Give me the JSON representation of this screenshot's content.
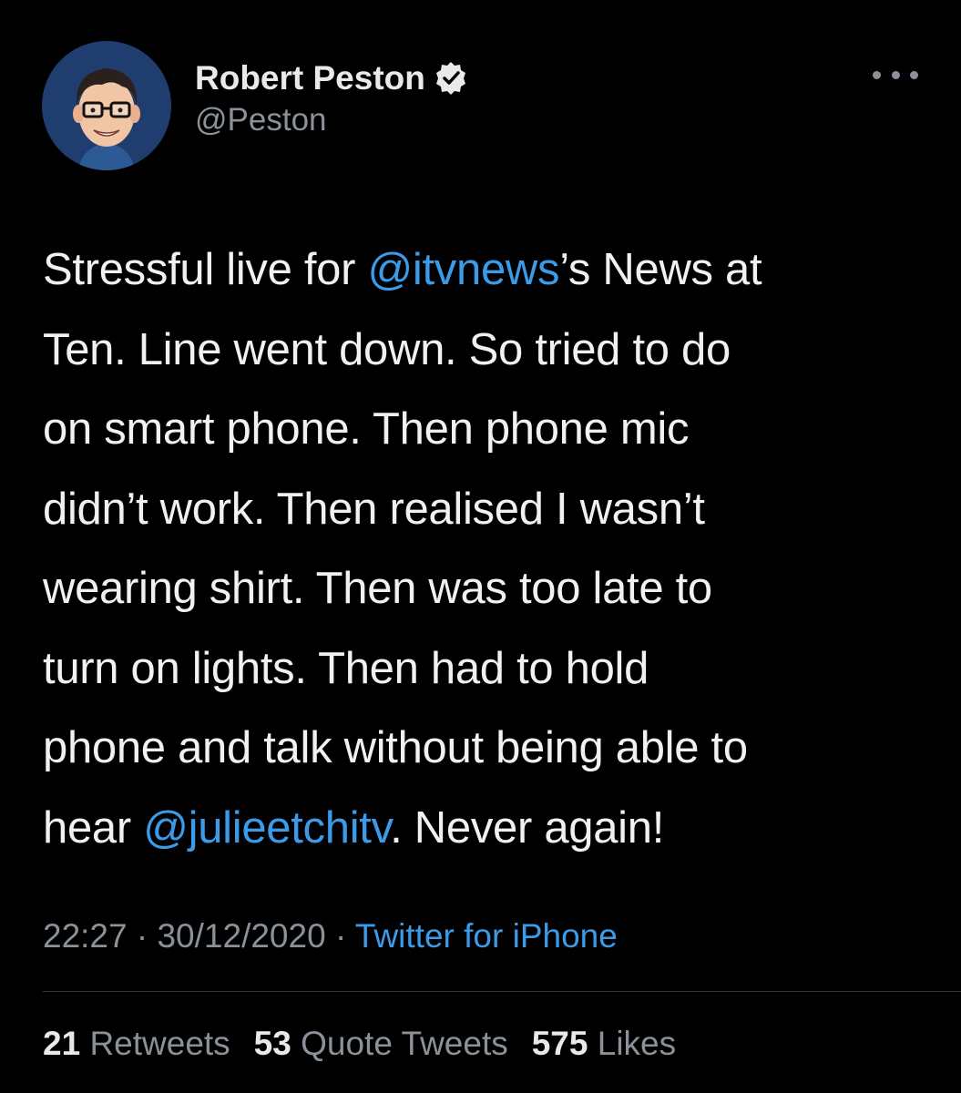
{
  "tweet": {
    "author": {
      "display_name": "Robert Peston",
      "handle": "@Peston",
      "verified": true,
      "avatar_icon": "cartoon-avatar-icon"
    },
    "more_icon": "more-options-icon",
    "text_lines": [
      [
        {
          "t": "Stressful live for "
        },
        {
          "t": "@itvnews",
          "mention": true
        },
        {
          "t": "’s News at"
        }
      ],
      [
        {
          "t": "Ten. Line went down. So tried to do"
        }
      ],
      [
        {
          "t": "on smart phone. Then phone mic"
        }
      ],
      [
        {
          "t": "didn’t work. Then realised I wasn’t"
        }
      ],
      [
        {
          "t": "wearing shirt. Then was too late to"
        }
      ],
      [
        {
          "t": "turn on lights. Then had to hold"
        }
      ],
      [
        {
          "t": "phone and talk without being able to"
        }
      ],
      [
        {
          "t": "hear "
        },
        {
          "t": "@julieetchitv",
          "mention": true
        },
        {
          "t": ". Never again!"
        }
      ]
    ],
    "time": "22:27",
    "date": "30/12/2020",
    "separator": "·",
    "source": "Twitter for iPhone",
    "stats": {
      "retweets_count": "21",
      "retweets_label": "Retweets",
      "quotes_count": "53",
      "quotes_label": "Quote Tweets",
      "likes_count": "575",
      "likes_label": "Likes"
    }
  },
  "colors": {
    "background": "#000000",
    "primary_text": "#e7e9ea",
    "secondary_text": "#8b9199",
    "link": "#3b9be8",
    "avatar_bg": "#1f3d6e"
  }
}
